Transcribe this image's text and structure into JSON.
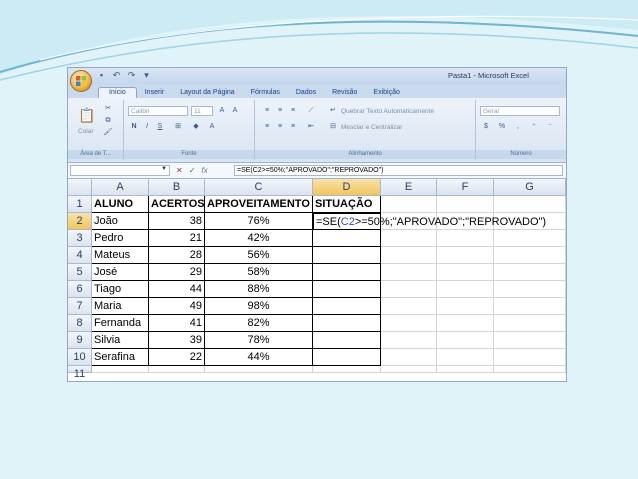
{
  "window": {
    "title": "Pasta1 - Microsoft Excel"
  },
  "ribbon": {
    "tabs": [
      "Início",
      "Inserir",
      "Layout da Página",
      "Fórmulas",
      "Dados",
      "Revisão",
      "Exibição"
    ],
    "groups": {
      "clipboard": "Área de T...",
      "font": "Fonte",
      "alignment": "Alinhamento",
      "number": "Número"
    },
    "paste_label": "Colar",
    "font_name": "Calibri",
    "font_size": "11",
    "wrap_text": "Quebrar Texto Automaticamente",
    "merge_center": "Mesclar e Centralizar",
    "number_format": "Geral"
  },
  "formula_bar": {
    "fx": "fx",
    "formula": "=SE(C2>=50%;\"APROVADO\";\"REPROVADO\")"
  },
  "sheet": {
    "columns": [
      "A",
      "B",
      "C",
      "D",
      "E",
      "F",
      "G"
    ],
    "row_numbers": [
      "1",
      "2",
      "3",
      "4",
      "5",
      "6",
      "7",
      "8",
      "9",
      "10",
      "11"
    ],
    "headers": [
      "ALUNO",
      "ACERTOS",
      "APROVEITAMENTO",
      "SITUAÇÃO"
    ],
    "rows": [
      {
        "aluno": "João",
        "acertos": "38",
        "aprov": "76%"
      },
      {
        "aluno": "Pedro",
        "acertos": "21",
        "aprov": "42%"
      },
      {
        "aluno": "Mateus",
        "acertos": "28",
        "aprov": "56%"
      },
      {
        "aluno": "José",
        "acertos": "29",
        "aprov": "58%"
      },
      {
        "aluno": "Tiago",
        "acertos": "44",
        "aprov": "88%"
      },
      {
        "aluno": "Maria",
        "acertos": "49",
        "aprov": "98%"
      },
      {
        "aluno": "Fernanda",
        "acertos": "41",
        "aprov": "82%"
      },
      {
        "aluno": "Silvia",
        "acertos": "39",
        "aprov": "78%"
      },
      {
        "aluno": "Serafina",
        "acertos": "22",
        "aprov": "44%"
      }
    ],
    "editing_cell": {
      "before": "=SE(",
      "ref": "C2",
      "after": ">=50%;\"APROVADO\";\"REPROVADO\")"
    }
  }
}
